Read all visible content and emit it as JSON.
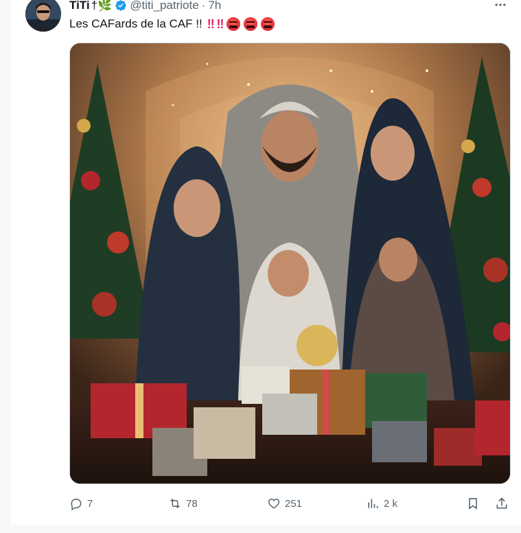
{
  "tweet": {
    "author_name": "TiTi",
    "name_emoji": "†🌿",
    "handle": "@titi_patriote",
    "separator": "·",
    "time": "7h",
    "text": "Les CAFards de la CAF !!",
    "bangs": "‼ ‼",
    "media_alt": "Family gathered around Christmas tree with gifts"
  },
  "actions": {
    "replies": "7",
    "reposts": "78",
    "likes": "251",
    "views": "2 k"
  },
  "icons": [
    "avatar",
    "verified-badge-icon",
    "more-icon",
    "reply-icon",
    "repost-icon",
    "like-icon",
    "views-icon",
    "bookmark-icon",
    "share-icon",
    "angry-face-icon"
  ],
  "colors": {
    "verified": "#1d9bf0",
    "bangs": "#e0245e",
    "muted_text": "#536471",
    "text": "#0f1419"
  }
}
